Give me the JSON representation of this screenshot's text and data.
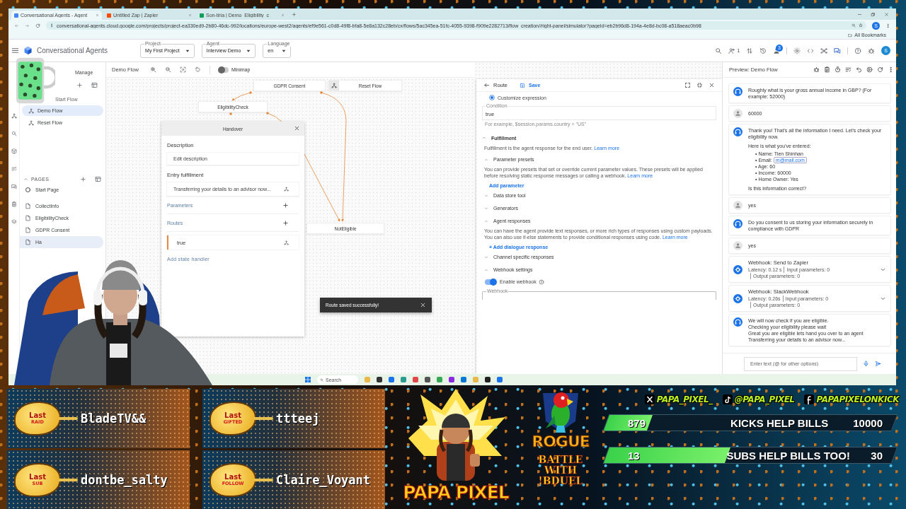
{
  "browser": {
    "tabs": [
      {
        "label": "Conversational Agents - Agent",
        "selected": true
      },
      {
        "label": "Untitled Zap | Zapier",
        "selected": false
      },
      {
        "label": "Son-tiria | Demo_Eligibility_c",
        "selected": false
      }
    ],
    "url": "conversational-agents.cloud.google.com/projects/project-ea330ed9-2b80-46dc-992/locations/europe-west2/agents/ef9e561-c0d8-49f8-bfa8-5e8a132c28eb/cx/flows/5ac345ea-51fc-4055-9398-f909e2282713/flow_creation//right-panel/simulator?pageId=eb2b96d8-194a-4e8d-bc08-a518aeac0b98",
    "bookmarks": "All Bookmarks",
    "profile": "S"
  },
  "app": {
    "title": "Conversational Agents",
    "selectors": [
      {
        "label": "Project",
        "value": "My First Project"
      },
      {
        "label": "Agent",
        "value": "Interview Demo"
      },
      {
        "label": "Language",
        "value": "en"
      }
    ],
    "collaborators": "1",
    "notification_count": "3",
    "avatar": "S"
  },
  "sidebar": {
    "manage": "Manage",
    "flows": [
      {
        "label": "Start Flow",
        "kind": "header",
        "selected": false
      },
      {
        "label": "Demo Flow",
        "kind": "flow",
        "selected": true
      },
      {
        "label": "Reset Flow",
        "kind": "flow",
        "selected": false
      }
    ],
    "pages_heading": "PAGES",
    "pages": [
      {
        "label": "Start Page",
        "kind": "start",
        "selected": false
      },
      {
        "label": "CollectInfo",
        "kind": "page",
        "selected": false
      },
      {
        "label": "EligibilityCheck",
        "kind": "page",
        "selected": false
      },
      {
        "label": "GDPR Consent",
        "kind": "page",
        "selected": false
      },
      {
        "label": "Ha",
        "kind": "page",
        "selected": true
      }
    ]
  },
  "canvas": {
    "title": "Demo Flow",
    "minimap": {
      "label": "Minimap",
      "on": false
    },
    "nodes": [
      {
        "label": "GDPR Consent",
        "kind": "page"
      },
      {
        "label": "Reset Flow",
        "kind": "flow"
      },
      {
        "label": "EligibilityCheck",
        "kind": "page"
      },
      {
        "label": "NotEligible",
        "kind": "page"
      }
    ]
  },
  "handover": {
    "title": "Handover",
    "description_heading": "Description",
    "description_placeholder": "Edit description",
    "entry_heading": "Entry fulfillment",
    "entry_text": "Transferring your details to an advisor now...",
    "parameters": "Parameters",
    "routes": "Routes",
    "route": "true",
    "add_handler": "Add state handler"
  },
  "route_panel": {
    "title": "Route",
    "save": "Save",
    "radio": {
      "label": "Customize expression",
      "selected": true
    },
    "condition": {
      "label": "Condition",
      "value": "true",
      "hint": "For example, $session.params.country = \"US\""
    },
    "sections": [
      {
        "kind": "section",
        "title": "Fulfillment",
        "expanded": true,
        "text": "Fulfillment is the agent response for the end user.",
        "link": "Learn more"
      },
      {
        "kind": "subsection",
        "title": "Parameter presets",
        "expanded": true,
        "text": "You can provide presets that set or override current parameter values. These presets will be applied before resolving static response messages or calling a webhook.",
        "link": "Learn more",
        "action": "Add parameter"
      },
      {
        "kind": "subsection",
        "title": "Data store tool",
        "expanded": false
      },
      {
        "kind": "subsection",
        "title": "Generators",
        "expanded": false
      },
      {
        "kind": "subsection",
        "title": "Agent responses",
        "expanded": true,
        "text": "You can have the agent provide text responses, or more rich types of responses using custom payloads. You can also use if-else statements to provide conditional responses using code.",
        "link": "Learn more",
        "action": "+ Add dialogue response"
      },
      {
        "kind": "subsection",
        "title": "Channel specific responses",
        "expanded": false
      },
      {
        "kind": "subsection",
        "title": "Webhook settings",
        "expanded": true
      }
    ],
    "webhook_toggle": {
      "label": "Enable webhook",
      "on": true
    },
    "webhook_field": "Webhook"
  },
  "preview": {
    "title": "Preview: Demo Flow",
    "messages": [
      {
        "kind": "agent",
        "lines": [
          "Roughly what is your gross annual income in GBP? (For example: 52000)"
        ]
      },
      {
        "kind": "user",
        "lines": [
          "60000"
        ]
      },
      {
        "kind": "agent",
        "lines": [
          "Thank you! That's all the information I need. Let's check your eligibility now."
        ],
        "intro": "Here is what you've entered:",
        "bullets": [
          {
            "marker": "•",
            "text": "Name: Tien Shinhan"
          },
          {
            "marker": "•",
            "text": "Email:",
            "chip": "m@mail.com"
          },
          {
            "marker": "•",
            "text": "Age: 60"
          },
          {
            "marker": "•",
            "text": "Income: 60000"
          },
          {
            "marker": "•",
            "text": "Home Owner: Yes"
          }
        ],
        "outro": "Is this information correct?"
      },
      {
        "kind": "user",
        "lines": [
          "yes"
        ]
      },
      {
        "kind": "agent",
        "lines": [
          "Do you consent to us storing your information securely in compliance with GDPR"
        ]
      },
      {
        "kind": "user",
        "lines": [
          "yes"
        ]
      },
      {
        "kind": "webhook",
        "title": "Webhook: Send to Zapier",
        "stats": [
          "Latency: 0.12 s",
          "Input parameters: 0",
          "Output parameters: 0"
        ],
        "expanded": false
      },
      {
        "kind": "webhook",
        "title": "Webhook: SlackWebhook",
        "stats": [
          "Latency: 0.26s",
          "Input parameters: 0",
          "Output parameters: 0"
        ],
        "expanded": false
      },
      {
        "kind": "agent",
        "lines": [
          "We will now check if you are eligible.",
          "Checking your eligibility please wait",
          "Great you are eligible lets hand you over to an agent",
          "Transferring your details to an advisor now..."
        ]
      }
    ],
    "input_placeholder": "Enter text (@ for other options)"
  },
  "toast": {
    "message": "Route saved successfully!"
  },
  "taskbar": {
    "search": "Search"
  },
  "overlay": {
    "cards": [
      {
        "title": "Last",
        "tag": "RAID",
        "name": "BladeTV&&"
      },
      {
        "title": "Last",
        "tag": "GIFTED",
        "name": "ttteej"
      },
      {
        "title": "Last",
        "tag": "SUB",
        "name": "dontbe_salty"
      },
      {
        "title": "Last",
        "tag": "FOLLOW",
        "name": "Claire_Voyant"
      }
    ],
    "logo": "PAPA PIXEL",
    "team": "ROGUE",
    "battle": "BATTLE WITH !BDUEL",
    "socials": [
      {
        "kind": "x",
        "handle": "PAPA_PIXEL_"
      },
      {
        "kind": "tiktok",
        "handle": "@PAPA_PIXEL"
      },
      {
        "kind": "facebook",
        "handle": "PAPAPIXELONKICK"
      }
    ],
    "goals": [
      {
        "current": "879",
        "label": "KICKS HELP BILLS",
        "target": "10000",
        "level": 0.15
      },
      {
        "current": "13",
        "label": "SUBS HELP BILLS TOO!",
        "target": "30",
        "level": 0.42
      }
    ]
  }
}
